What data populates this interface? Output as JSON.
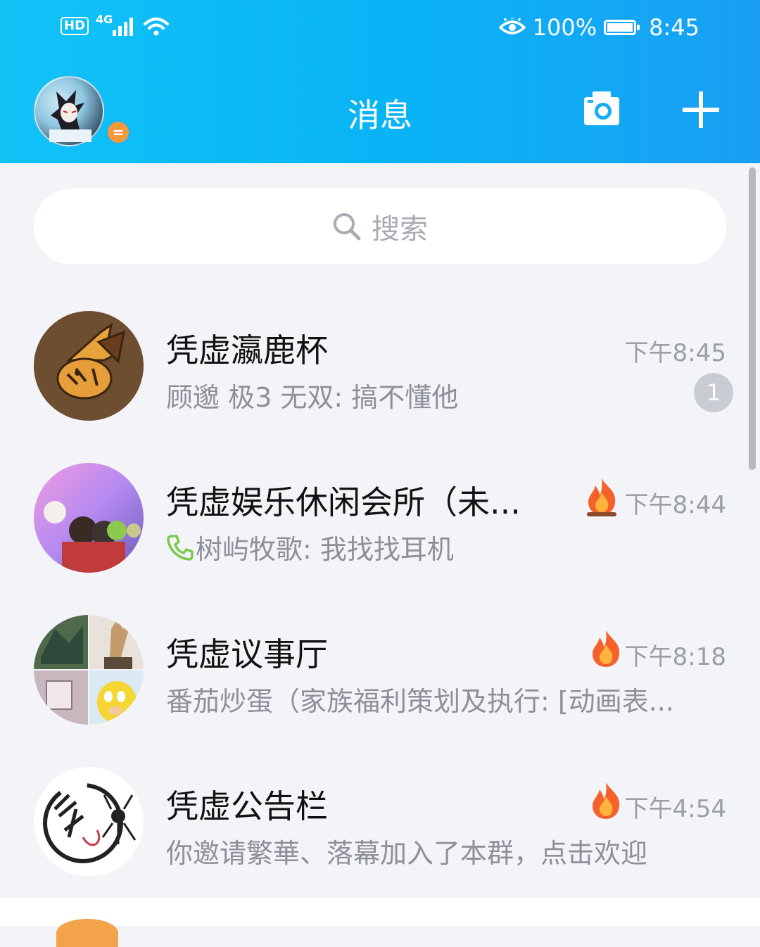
{
  "status_bar": {
    "hd": "HD",
    "network": "4G",
    "battery_percent": "100%",
    "battery_level": 1.0,
    "time": "8:45",
    "icons": [
      "signal-icon",
      "wifi-icon",
      "eye-icon",
      "battery-icon"
    ]
  },
  "header": {
    "title": "消息",
    "status_badge": "=",
    "camera_icon": "camera-icon",
    "plus_icon": "plus-icon"
  },
  "search": {
    "placeholder": "搜索",
    "icon": "search-icon"
  },
  "conversations": [
    {
      "name": "凭虚瀛鹿杯",
      "time": "下午8:45",
      "preview": "顾邈 极3 无双: 搞不懂他",
      "unread": "1",
      "fire": false,
      "call_icon": false
    },
    {
      "name": "凭虚娱乐休闲会所（未...",
      "time": "下午8:44",
      "preview": "树屿牧歌: 我找找耳机",
      "unread": "",
      "fire": true,
      "call_icon": true
    },
    {
      "name": "凭虚议事厅",
      "time": "下午8:18",
      "preview": "番茄炒蛋（家族福利策划及执行: [动画表...",
      "unread": "",
      "fire": true,
      "call_icon": false
    },
    {
      "name": "凭虚公告栏",
      "time": "下午4:54",
      "preview": "你邀请繁華、落幕加入了本群，点击欢迎",
      "unread": "",
      "fire": true,
      "call_icon": false
    }
  ],
  "colors": {
    "header_gradient_start": "#11c3f7",
    "header_gradient_end": "#1a9ff3",
    "background": "#f3f4f8",
    "fire": "#f5612a",
    "call_icon": "#7ac94a",
    "unread_badge": "#c9ccd3"
  }
}
